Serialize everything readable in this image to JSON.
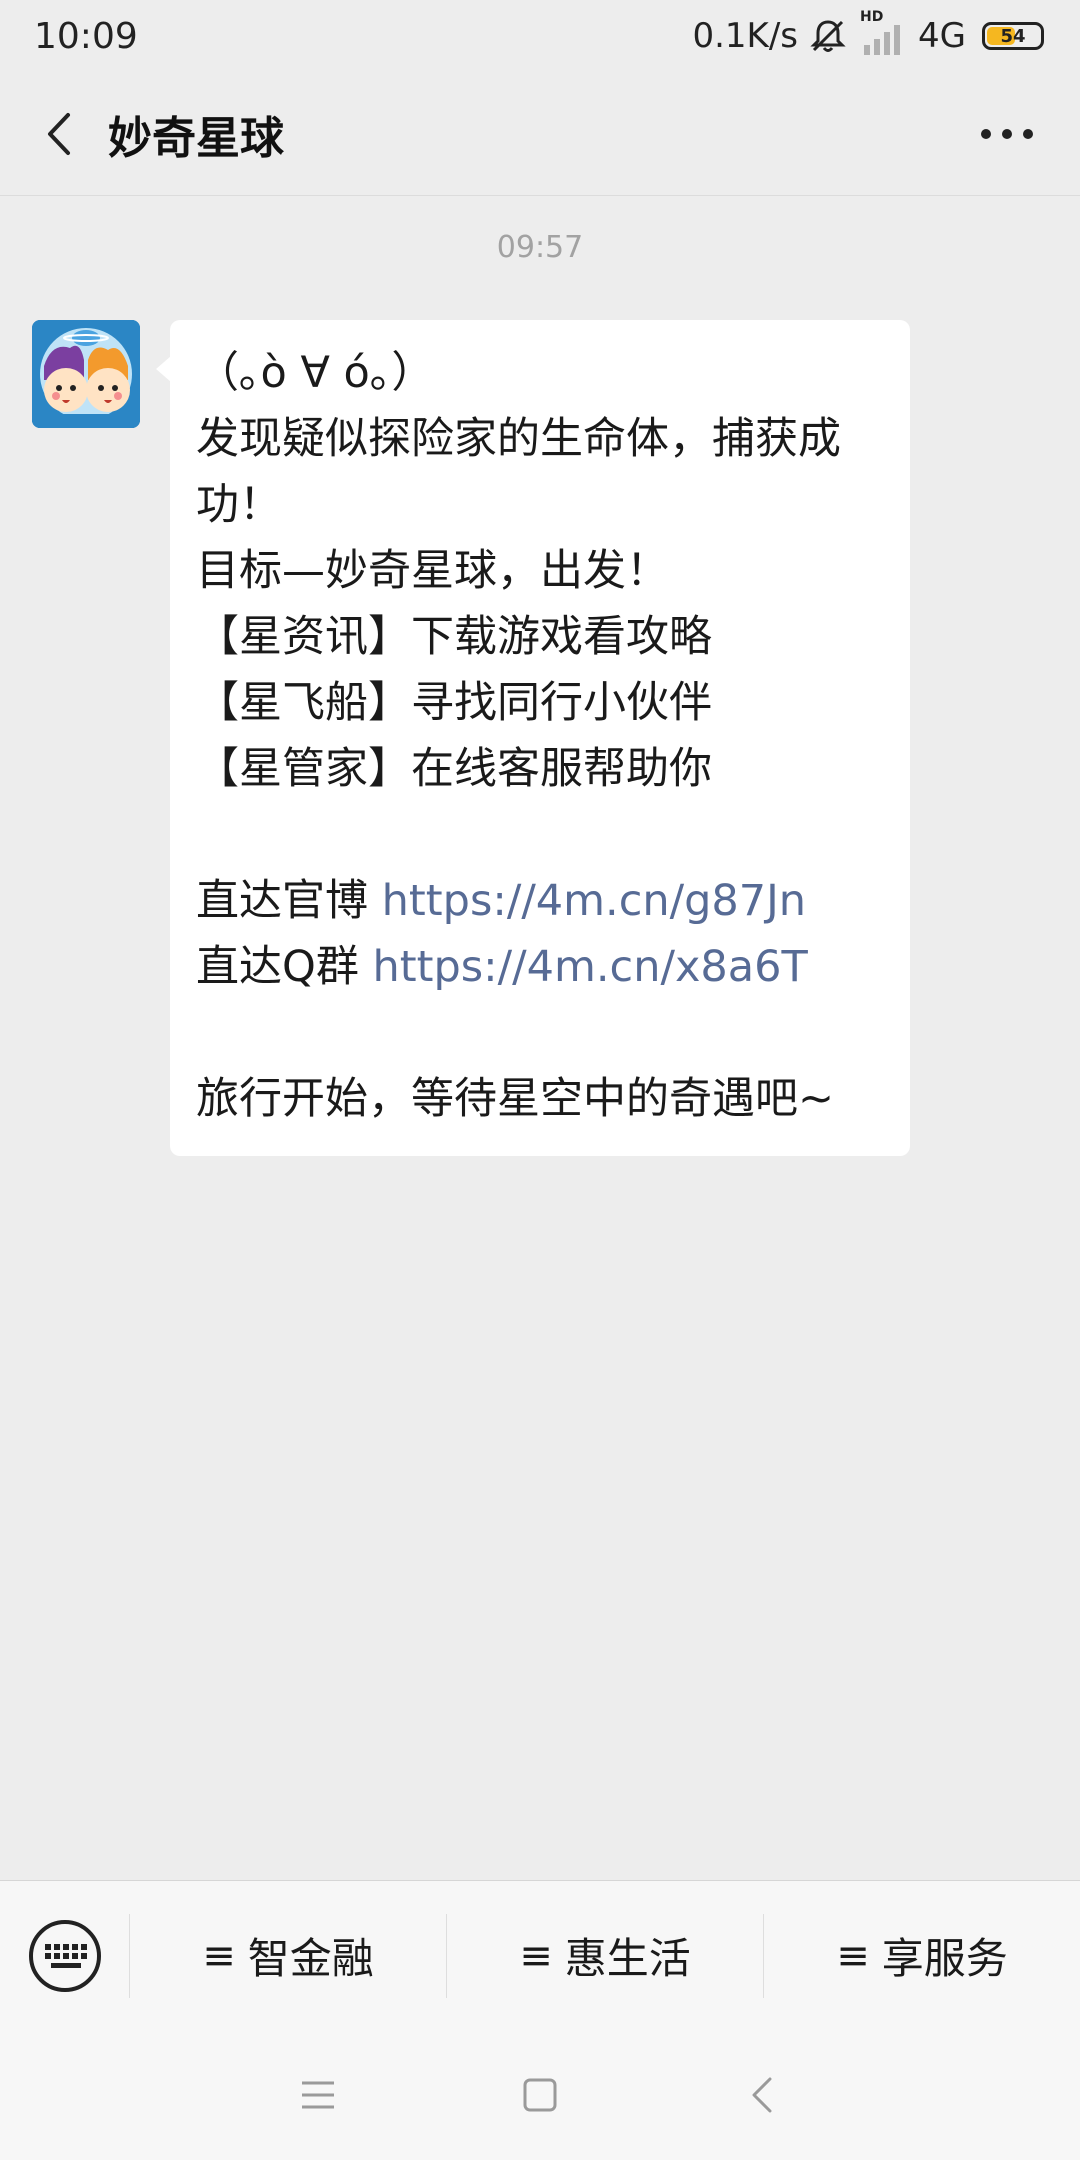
{
  "status_bar": {
    "time": "10:09",
    "net_speed": "0.1K/s",
    "hd": "HD",
    "network": "4G",
    "battery": "54",
    "battery_level": 0.54
  },
  "nav": {
    "title": "妙奇星球"
  },
  "chat": {
    "timestamp": "09:57",
    "message_lines": [
      {
        "text": "（｡ò ∀ ó｡）",
        "link": ""
      },
      {
        "text": "发现疑似探险家的生命体，捕获成功！",
        "link": ""
      },
      {
        "text": "目标—妙奇星球，出发！",
        "link": ""
      },
      {
        "text": "【星资讯】下载游戏看攻略",
        "link": ""
      },
      {
        "text": "【星飞船】寻找同行小伙伴",
        "link": ""
      },
      {
        "text": "【星管家】在线客服帮助你",
        "link": ""
      },
      {
        "text": "",
        "link": ""
      },
      {
        "text": "直达官博 ",
        "link": "https://4m.cn/g87Jn"
      },
      {
        "text": "直达Q群 ",
        "link": "https://4m.cn/x8a6T"
      },
      {
        "text": "",
        "link": ""
      },
      {
        "text": "旅行开始，等待星空中的奇遇吧~",
        "link": ""
      }
    ]
  },
  "menu": {
    "items": [
      {
        "label": "智金融"
      },
      {
        "label": "惠生活"
      },
      {
        "label": "享服务"
      }
    ]
  },
  "colors": {
    "link": "#576b95",
    "background": "#ededed",
    "bubble": "#ffffff",
    "battery": "#f5b720"
  },
  "icons": {
    "back": "chevron-left-icon",
    "more": "more-dots-icon",
    "keyboard": "keyboard-icon",
    "menu": "menu-lines-icon"
  }
}
